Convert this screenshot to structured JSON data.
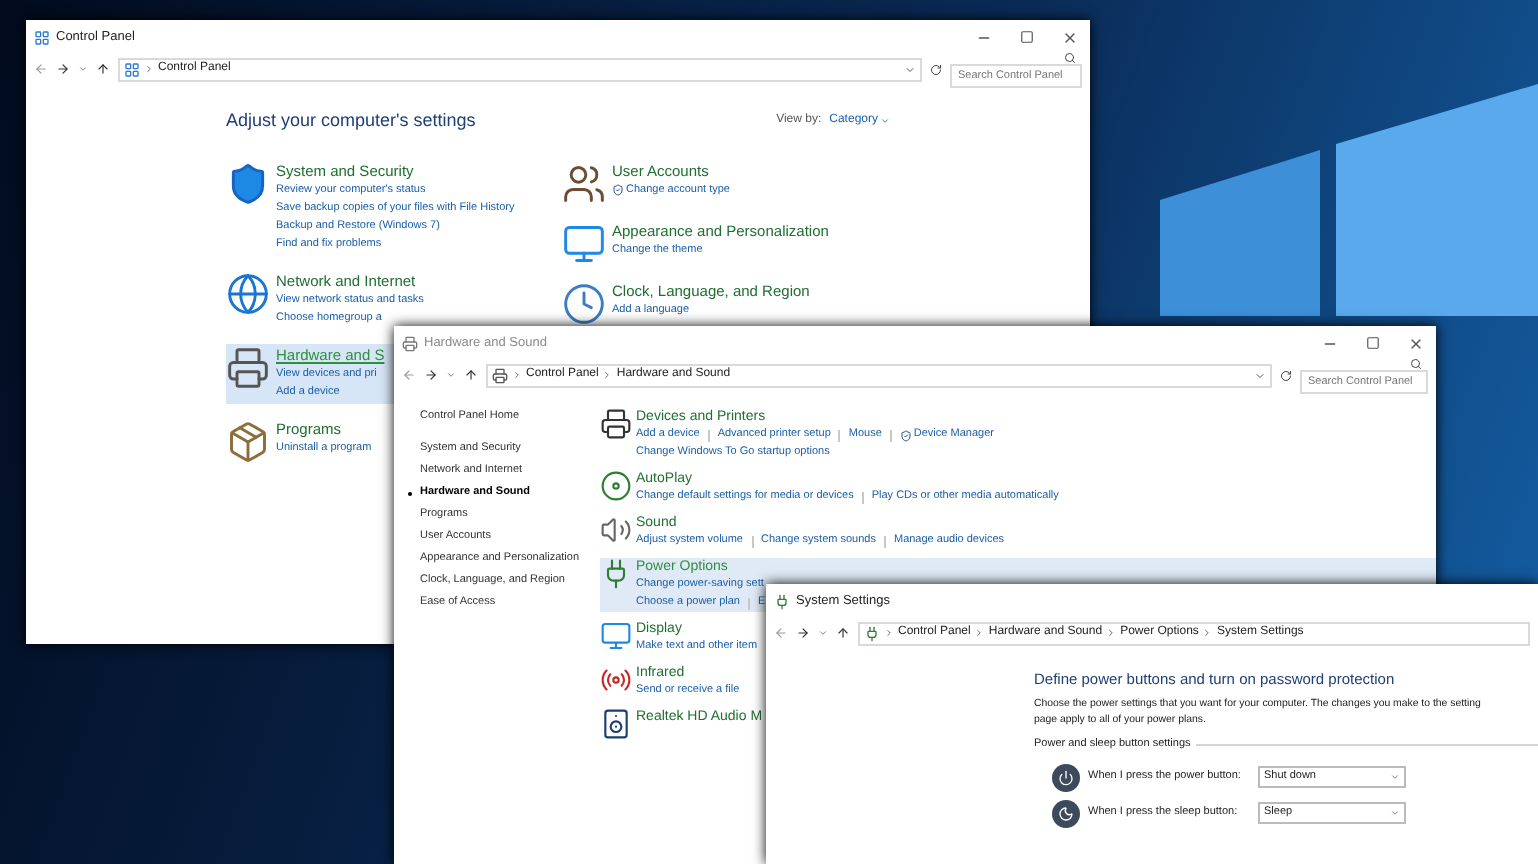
{
  "control_panel_window": {
    "title": "Control Panel",
    "breadcrumbs": [
      "Control Panel"
    ],
    "search": {
      "placeholder": "Search Control Panel"
    },
    "heading": "Adjust your computer's settings",
    "view_by": {
      "label": "View by:",
      "value": "Category"
    },
    "left_categories": [
      {
        "title": "System and Security",
        "selected": false,
        "links": [
          {
            "text": "Review your computer's status",
            "shield": false
          },
          {
            "text": "Save backup copies of your files with File History",
            "shield": false
          },
          {
            "text": "Backup and Restore (Windows 7)",
            "shield": false
          },
          {
            "text": "Find and fix problems",
            "shield": false
          }
        ]
      },
      {
        "title": "Network and Internet",
        "selected": false,
        "links": [
          {
            "text": "View network status and tasks",
            "shield": false
          },
          {
            "text": "Choose homegroup a",
            "shield": false
          }
        ]
      },
      {
        "title": "Hardware and S",
        "selected": true,
        "links": [
          {
            "text": "View devices and pri",
            "shield": false
          },
          {
            "text": "Add a device",
            "shield": false
          }
        ]
      },
      {
        "title": "Programs",
        "selected": false,
        "links": [
          {
            "text": "Uninstall a program",
            "shield": false
          }
        ]
      }
    ],
    "right_categories": [
      {
        "title": "User Accounts",
        "selected": false,
        "links": [
          {
            "text": "Change account type",
            "shield": true
          }
        ]
      },
      {
        "title": "Appearance and Personalization",
        "selected": false,
        "links": [
          {
            "text": "Change the theme",
            "shield": false
          }
        ]
      },
      {
        "title": "Clock, Language, and Region",
        "selected": false,
        "links": [
          {
            "text": "Add a language",
            "shield": false
          }
        ]
      }
    ]
  },
  "hardware_sound_window": {
    "title": "Hardware and Sound",
    "breadcrumbs": [
      "Control Panel",
      "Hardware and Sound"
    ],
    "search": {
      "placeholder": "Search Control Panel"
    },
    "nav": [
      {
        "label": "Control Panel Home",
        "kind": "home",
        "selected": false
      },
      {
        "label": "System and Security",
        "kind": "category",
        "selected": false
      },
      {
        "label": "Network and Internet",
        "kind": "category",
        "selected": false
      },
      {
        "label": "Hardware and Sound",
        "kind": "category",
        "selected": true
      },
      {
        "label": "Programs",
        "kind": "category",
        "selected": false
      },
      {
        "label": "User Accounts",
        "kind": "category",
        "selected": false
      },
      {
        "label": "Appearance and Personalization",
        "kind": "category",
        "selected": false
      },
      {
        "label": "Clock, Language, and Region",
        "kind": "category",
        "selected": false
      },
      {
        "label": "Ease of Access",
        "kind": "category",
        "selected": false
      }
    ],
    "sections": [
      {
        "title": "Devices and Printers",
        "selected": false,
        "link_lines": [
          [
            {
              "text": "Add a device",
              "shield": false
            },
            {
              "text": "Advanced printer setup",
              "shield": false
            },
            {
              "text": "Mouse",
              "shield": false
            },
            {
              "text": "Device Manager",
              "shield": true
            }
          ],
          [
            {
              "text": "Change Windows To Go startup options",
              "shield": false
            }
          ]
        ]
      },
      {
        "title": "AutoPlay",
        "selected": false,
        "link_lines": [
          [
            {
              "text": "Change default settings for media or devices",
              "shield": false
            },
            {
              "text": "Play CDs or other media automatically",
              "shield": false
            }
          ]
        ]
      },
      {
        "title": "Sound",
        "selected": false,
        "link_lines": [
          [
            {
              "text": "Adjust system volume",
              "shield": false
            },
            {
              "text": "Change system sounds",
              "shield": false
            },
            {
              "text": "Manage audio devices",
              "shield": false
            }
          ]
        ]
      },
      {
        "title": "Power Options",
        "selected": true,
        "link_lines": [
          [
            {
              "text": "Change power-saving sett",
              "shield": false
            }
          ],
          [
            {
              "text": "Choose a power plan",
              "shield": false
            },
            {
              "text": "E",
              "shield": false
            }
          ]
        ]
      },
      {
        "title": "Display",
        "selected": false,
        "link_lines": [
          [
            {
              "text": "Make text and other item",
              "shield": false
            }
          ]
        ]
      },
      {
        "title": "Infrared",
        "selected": false,
        "link_lines": [
          [
            {
              "text": "Send or receive a file",
              "shield": false
            }
          ]
        ]
      },
      {
        "title": "Realtek HD Audio M",
        "selected": false
      }
    ]
  },
  "system_settings_window": {
    "title": "System Settings",
    "breadcrumbs": [
      "Control Panel",
      "Hardware and Sound",
      "Power Options",
      "System Settings"
    ],
    "heading": "Define power buttons and turn on password protection",
    "description_lines": [
      "Choose the power settings that you want for your computer. The changes you make to the setting",
      "page apply to all of your power plans."
    ],
    "group_label": "Power and sleep button settings",
    "rows": [
      {
        "kind": "power",
        "label": "When I press the power button:",
        "value": "Shut down"
      },
      {
        "kind": "sleep",
        "label": "When I press the sleep button:",
        "value": "Sleep"
      }
    ]
  }
}
